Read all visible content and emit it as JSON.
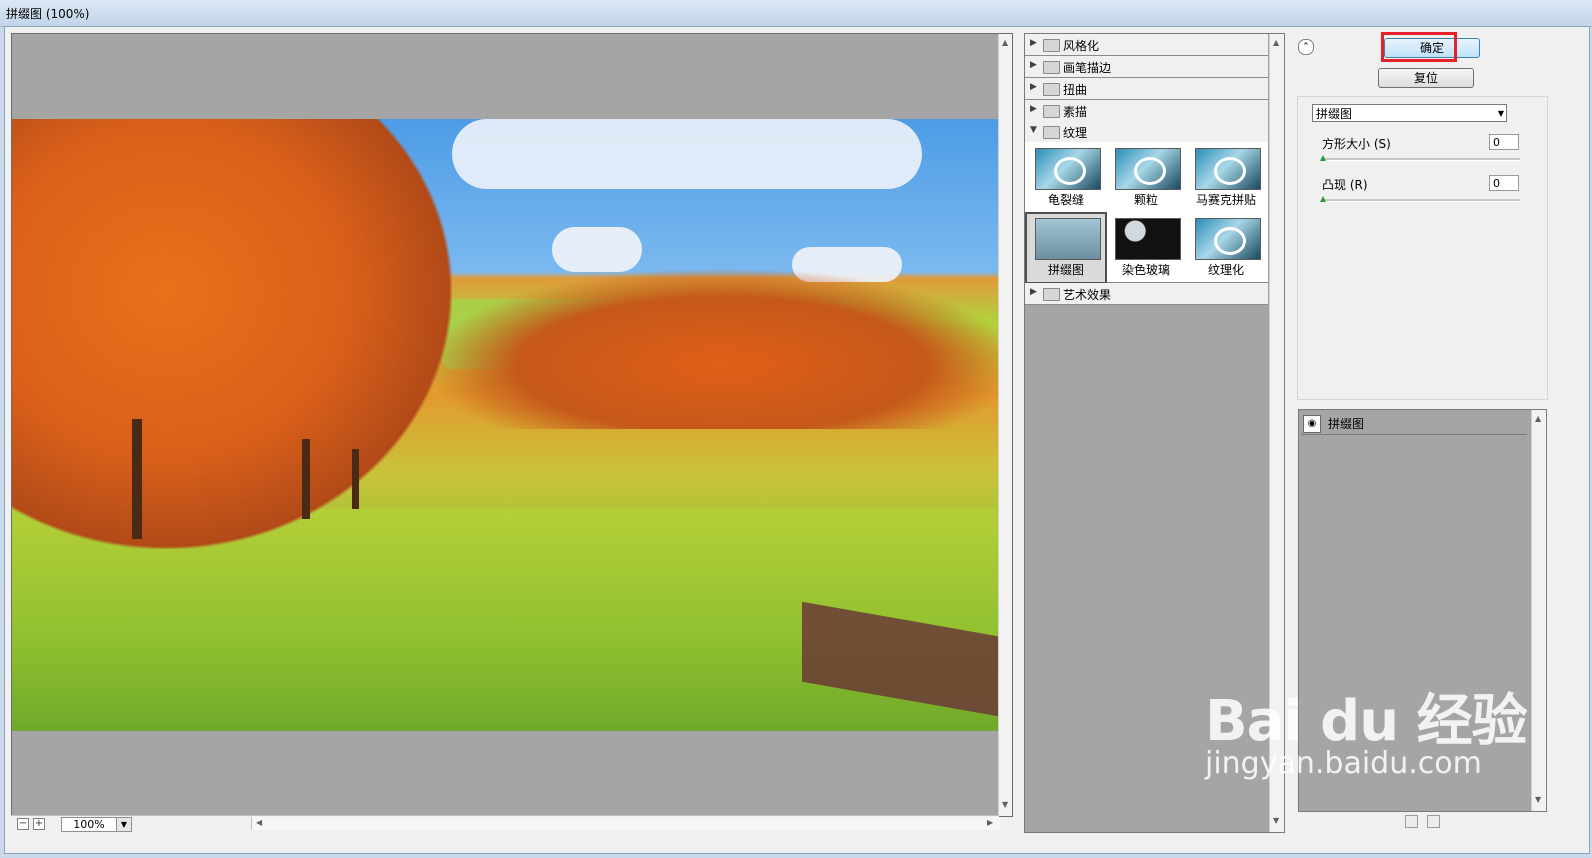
{
  "window": {
    "title": "拼缀图 (100%)"
  },
  "preview": {
    "zoom_value": "100%"
  },
  "gallery": {
    "categories_top": [
      {
        "label": "风格化",
        "expanded": false
      },
      {
        "label": "画笔描边",
        "expanded": false
      },
      {
        "label": "扭曲",
        "expanded": false
      },
      {
        "label": "素描",
        "expanded": false
      },
      {
        "label": "纹理",
        "expanded": true
      }
    ],
    "texture_filters": [
      "龟裂缝",
      "颗粒",
      "马赛克拼贴",
      "拼缀图",
      "染色玻璃",
      "纹理化"
    ],
    "selected_filter": "拼缀图",
    "categories_bottom": [
      {
        "label": "艺术效果",
        "expanded": false
      }
    ]
  },
  "buttons": {
    "ok": "确定",
    "reset": "复位"
  },
  "settings": {
    "filter_select": "拼缀图",
    "params": [
      {
        "label": "方形大小 (S)",
        "value": "0"
      },
      {
        "label": "凸现 (R)",
        "value": "0"
      }
    ]
  },
  "layers": {
    "items": [
      {
        "name": "拼缀图",
        "visible": true
      }
    ]
  },
  "watermark": {
    "logo_text": "Bai du 经验",
    "url": "jingyan.baidu.com"
  },
  "colors": {
    "highlight_red": "#e8202a",
    "ok_button_blue": "#bfe2f8",
    "panel_gray": "#a5a5a5"
  }
}
